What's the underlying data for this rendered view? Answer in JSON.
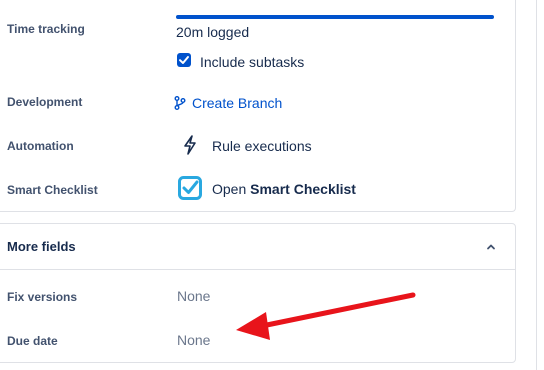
{
  "time_tracking": {
    "label": "Time tracking",
    "logged": "20m logged",
    "progress_fraction": 1.0,
    "include_subtasks_label": "Include subtasks",
    "include_subtasks_checked": true
  },
  "development": {
    "label": "Development",
    "create_branch_label": "Create Branch"
  },
  "automation": {
    "label": "Automation",
    "rule_executions_label": "Rule executions"
  },
  "smart_checklist": {
    "label": "Smart Checklist",
    "open_prefix": "Open",
    "open_name": "Smart Checklist"
  },
  "more_fields": {
    "title": "More fields",
    "fix_versions": {
      "label": "Fix versions",
      "value": "None"
    },
    "due_date": {
      "label": "Due date",
      "value": "None"
    }
  },
  "colors": {
    "link": "#0052cc",
    "progress": "#0052cc",
    "checklist_icon": "#29a8e0",
    "annotation_arrow": "#e8141b"
  },
  "icons": {
    "branch": "branch-icon",
    "lightning": "lightning-icon",
    "checklist": "checklist-icon",
    "chevron": "chevron-up-icon",
    "arrow": "annotation-arrow"
  }
}
